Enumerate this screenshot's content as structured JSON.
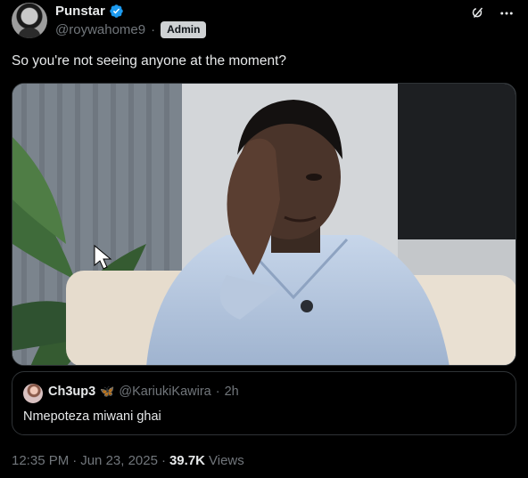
{
  "author": {
    "display_name": "Punstar",
    "handle": "@roywahome9",
    "separator": "·",
    "badge": "Admin",
    "verified": true
  },
  "icons": {
    "verified": "verified-badge-icon",
    "grok": "grok-icon",
    "more": "more-icon"
  },
  "tweet": {
    "text": "So you're not seeing anyone at the moment?"
  },
  "media": {
    "description_icon": "photo-image"
  },
  "quote": {
    "display_name": "Ch3up3",
    "emoji": "🦋",
    "handle": "@KariukiKawira",
    "separator": "·",
    "time": "2h",
    "text": "Nmepoteza miwani ghai"
  },
  "meta": {
    "time": "12:35 PM",
    "sep1": "·",
    "date": "Jun 23, 2025",
    "sep2": "·",
    "views_count": "39.7K",
    "views_label": "Views"
  },
  "colors": {
    "background": "#000000",
    "text": "#e7e9ea",
    "muted": "#71767b",
    "verified": "#1d9bf0",
    "border": "#2f3336"
  }
}
